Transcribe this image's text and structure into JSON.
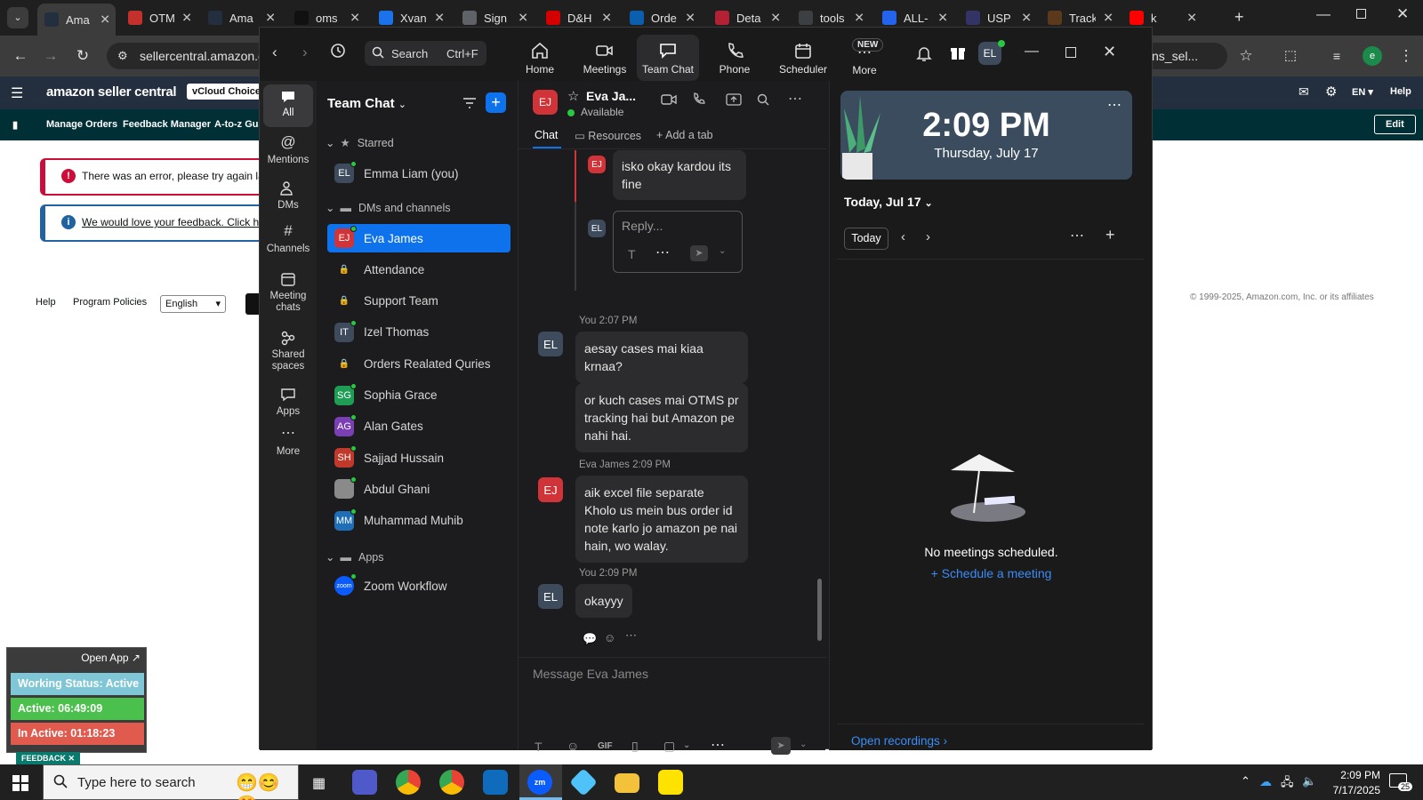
{
  "browser": {
    "tabs": [
      {
        "label": "Ama",
        "icon": "amazon-icon",
        "color": "#232f3e",
        "active": true
      },
      {
        "label": "OTM",
        "icon": "otm-icon",
        "color": "#c4302b"
      },
      {
        "label": "Ama",
        "icon": "amazon-icon",
        "color": "#232f3e"
      },
      {
        "label": "oms",
        "icon": "oms-icon",
        "color": "#111111"
      },
      {
        "label": "Xvan",
        "icon": "xvan-icon",
        "color": "#1a73e8"
      },
      {
        "label": "Sign",
        "icon": "globe-icon",
        "color": "#5f6368"
      },
      {
        "label": "D&H",
        "icon": "dh-icon",
        "color": "#d40000"
      },
      {
        "label": "Orde",
        "icon": "ec-icon",
        "color": "#0b5fae"
      },
      {
        "label": "Deta",
        "icon": "flag-icon",
        "color": "#b22234"
      },
      {
        "label": "tools",
        "icon": "document-icon",
        "color": "#3c4043"
      },
      {
        "label": "ALL-",
        "icon": "17track-icon",
        "color": "#2463eb"
      },
      {
        "label": "USP",
        "icon": "usps-icon",
        "color": "#333366"
      },
      {
        "label": "Track",
        "icon": "ups-icon",
        "color": "#5a3a1a"
      },
      {
        "label": "k",
        "icon": "youtube-icon",
        "color": "#ff0000"
      }
    ],
    "url": "sellercentral.amazon.c",
    "url_tail": "ns_sel...",
    "profile_initial": "e"
  },
  "amazon": {
    "logo": "amazon seller central",
    "store": "vCloud Choice",
    "lang": "EN",
    "help": "Help",
    "nav": [
      "Manage Orders",
      "Feedback Manager",
      "A-to-z Gua"
    ],
    "edit": "Edit",
    "error_text": "There was an error, please try again late",
    "feedback_text": "We would love your feedback. Click here",
    "footer": {
      "help": "Help",
      "policies": "Program Policies",
      "language": "English",
      "copyright": "© 1999-2025, Amazon.com, Inc. or its affiliates"
    }
  },
  "zoom": {
    "search": {
      "label": "Search",
      "shortcut": "Ctrl+F"
    },
    "tabs": [
      "Home",
      "Meetings",
      "Team Chat",
      "Phone",
      "Scheduler",
      "More"
    ],
    "new_badge": "NEW",
    "user_initials": "EL",
    "rail": [
      "All",
      "Mentions",
      "DMs",
      "Channels",
      "Meeting chats",
      "Shared spaces",
      "Apps",
      "More"
    ],
    "list": {
      "title": "Team Chat",
      "starred_label": "Starred",
      "starred": [
        {
          "name": "Emma Liam (you)",
          "initials": "EL",
          "color": "#3d4b5c"
        }
      ],
      "dms_label": "DMs and channels",
      "dms": [
        {
          "name": "Eva James",
          "initials": "EJ",
          "color": "#d13438",
          "selected": true
        },
        {
          "name": "Attendance",
          "initials": "",
          "color": "#3a3a3c",
          "lock": true
        },
        {
          "name": "Support Team",
          "initials": "",
          "color": "#3a3a3c",
          "lock": true
        },
        {
          "name": "Izel Thomas",
          "initials": "IT",
          "color": "#3d4b5c"
        },
        {
          "name": "Orders Realated Quries",
          "initials": "",
          "color": "#3a3a3c",
          "lock": true
        },
        {
          "name": "Sophia Grace",
          "initials": "SG",
          "color": "#1f9d55"
        },
        {
          "name": "Alan Gates",
          "initials": "AG",
          "color": "#7b3fb5"
        },
        {
          "name": "Sajjad Hussain",
          "initials": "SH",
          "color": "#c0392b"
        },
        {
          "name": "Abdul Ghani",
          "initials": "",
          "color": "#8a8a8a"
        },
        {
          "name": "Muhammad Muhib",
          "initials": "MM",
          "color": "#1e6fb8"
        }
      ],
      "apps_label": "Apps",
      "apps": [
        {
          "name": "Zoom Workflow",
          "initials": "zoom",
          "color": "#0b5cff"
        }
      ]
    },
    "chat": {
      "contact": "Eva Ja...",
      "contact_initials": "EJ",
      "status": "Available",
      "tabs": [
        "Chat",
        "Resources",
        "Add a tab"
      ],
      "thread_reply": {
        "initials": "EJ",
        "text": "isko okay kardou its fine"
      },
      "reply_placeholder": "Reply...",
      "reply_initials": "EL",
      "messages": [
        {
          "meta": "You 2:07 PM",
          "initials": "EL",
          "texts": [
            "aesay cases mai kiaa krnaa?",
            "or kuch cases mai OTMS pr tracking hai but Amazon pe nahi hai."
          ]
        },
        {
          "meta": "Eva James 2:09 PM",
          "initials": "EJ",
          "texts": [
            "aik excel file separate Kholo us mein bus order id note karlo jo amazon pe nai hain, wo walay."
          ]
        },
        {
          "meta": "You 2:09 PM",
          "initials": "EL",
          "texts": [
            "okayyy"
          ]
        }
      ],
      "composer_placeholder": "Message Eva James",
      "gif": "GIF"
    },
    "calendar": {
      "time": "2:09 PM",
      "date": "Thursday, July 17",
      "day_label": "Today, Jul 17",
      "today_btn": "Today",
      "empty": "No meetings scheduled.",
      "schedule": "Schedule a meeting",
      "recordings": "Open recordings"
    }
  },
  "widget": {
    "open_app": "Open App ↗",
    "status": "Working Status: Active",
    "active": "Active: 06:49:09",
    "inactive": "In Active: 01:18:23",
    "feedback": "FEEDBACK ✕"
  },
  "taskbar": {
    "search_placeholder": "Type here to search",
    "time": "2:09 PM",
    "date": "7/17/2025",
    "notifications": "25"
  }
}
